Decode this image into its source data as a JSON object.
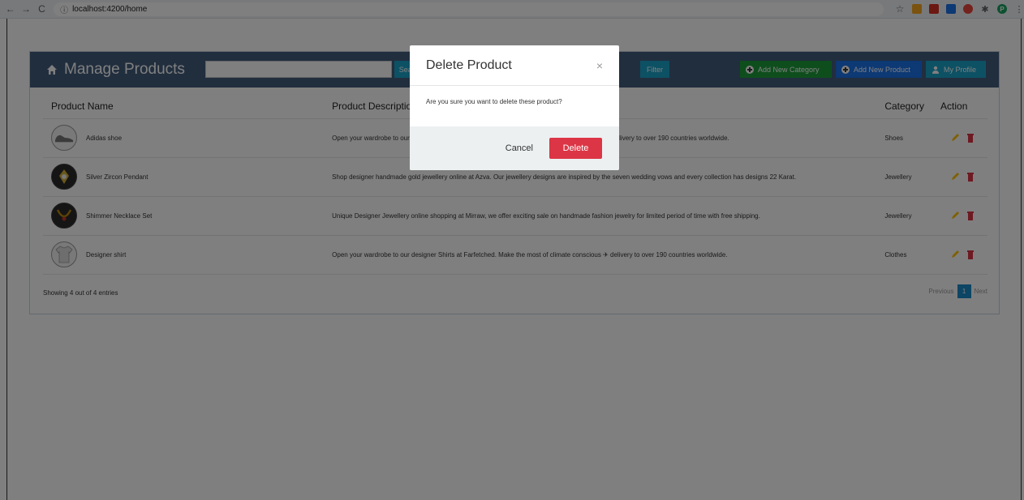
{
  "browser": {
    "url": "localhost:4200/home"
  },
  "header": {
    "title": "Manage Products",
    "search_placeholder": "",
    "search_label": "Search",
    "filter_label": "Filter",
    "add_category_label": "Add New Category",
    "add_product_label": "Add New Product",
    "profile_label": "My Profile"
  },
  "table": {
    "columns": [
      "Product Name",
      "Product Description",
      "Category",
      "Action"
    ],
    "rows": [
      {
        "name": "Adidas shoe",
        "description": "Open your wardrobe to our designer Shoes at Farfetched. Make the most of climate conscious ✈ delivery to over 190 countries worldwide.",
        "category": "Shoes"
      },
      {
        "name": "Silver Zircon Pendant",
        "description": "Shop designer handmade gold jewellery online at Azva. Our jewellery designs are inspired by the seven wedding vows and every collection has designs 22 Karat.",
        "category": "Jewellery"
      },
      {
        "name": "Shimmer Necklace Set",
        "description": "Unique Designer Jewellery online shopping at Mirraw, we offer exciting sale on handmade fashion jewelry for limited period of time with free shipping.",
        "category": "Jewellery"
      },
      {
        "name": "Designer shirt",
        "description": "Open your wardrobe to our designer Shirts at Farfetched. Make the most of climate conscious ✈ delivery to over 190 countries worldwide.",
        "category": "Clothes"
      }
    ]
  },
  "footer": {
    "info": "Showing 4 out of 4 entries",
    "prev": "Previous",
    "page": "1",
    "next": "Next"
  },
  "modal": {
    "title": "Delete Product",
    "close": "×",
    "body": "Are you sure you want to delete these product?",
    "cancel": "Cancel",
    "delete": "Delete"
  },
  "colors": {
    "header_bg": "#435d7d",
    "delete": "#dc3545",
    "add_category": "#1d9d3b",
    "add_product": "#1a73e8",
    "info": "#1aa3c9",
    "edit": "#ffc107"
  }
}
